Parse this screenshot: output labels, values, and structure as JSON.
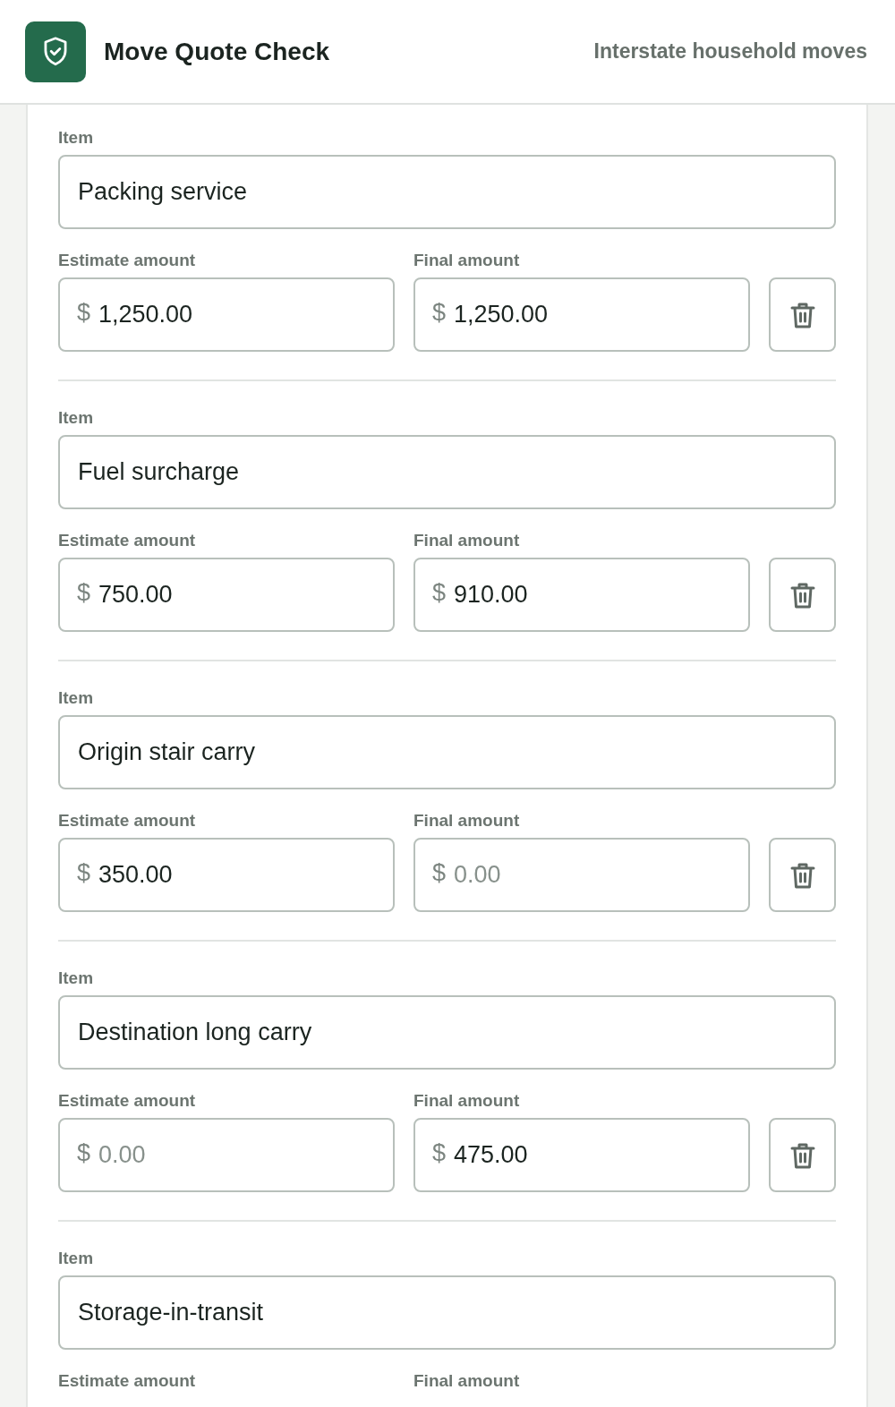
{
  "header": {
    "title": "Move Quote Check",
    "subtitle": "Interstate household moves"
  },
  "items": [
    {
      "item_label": "Item",
      "item_value": "Packing service",
      "estimate": {
        "label": "Estimate amount",
        "currency": "$",
        "value": "1,250.00"
      },
      "final": {
        "label": "Final amount",
        "currency": "$",
        "value": "1,250.00"
      },
      "delete_button": true
    },
    {
      "item_label": "Item",
      "item_value": "Fuel surcharge",
      "estimate": {
        "label": "Estimate amount",
        "currency": "$",
        "value": "750.00"
      },
      "final": {
        "label": "Final amount",
        "currency": "$",
        "value": "910.00"
      },
      "delete_button": true
    },
    {
      "item_label": "Item",
      "item_value": "Origin stair carry",
      "estimate": {
        "label": "Estimate amount",
        "currency": "$",
        "value": "350.00"
      },
      "final": {
        "label": "Final amount",
        "currency": "$",
        "placeholder": "0.00"
      },
      "delete_button": true
    },
    {
      "item_label": "Item",
      "item_value": "Destination long carry",
      "estimate": {
        "label": "Estimate amount",
        "currency": "$",
        "placeholder": "0.00"
      },
      "final": {
        "label": "Final amount",
        "currency": "$",
        "value": "475.00"
      },
      "delete_button": true
    },
    {
      "item_label": "Item",
      "item_value": "Storage-in-transit",
      "estimate": {
        "label": "Estimate amount"
      },
      "final": {
        "label": "Final amount"
      },
      "delete_button": false
    }
  ]
}
